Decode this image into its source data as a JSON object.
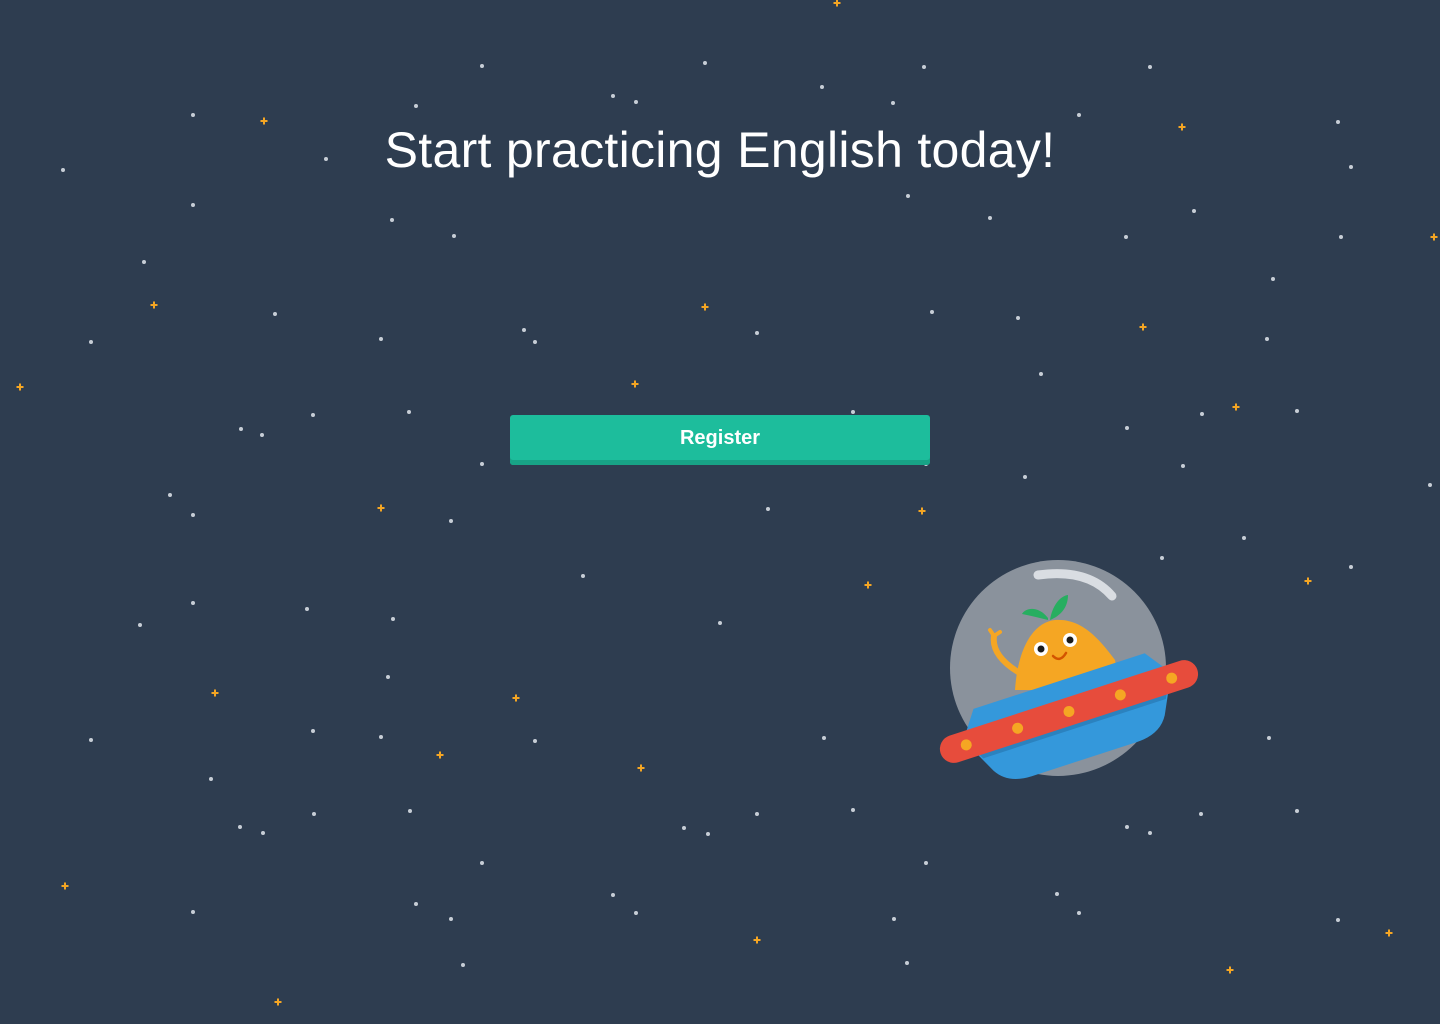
{
  "hero": {
    "title": "Start practicing English today!"
  },
  "actions": {
    "register_label": "Register"
  },
  "colors": {
    "background": "#2e3d50",
    "accent": "#1dbd9c",
    "star_white": "#c7ced6",
    "star_yellow": "#f5a623"
  },
  "illustration": {
    "name": "mascot-in-ufo"
  }
}
